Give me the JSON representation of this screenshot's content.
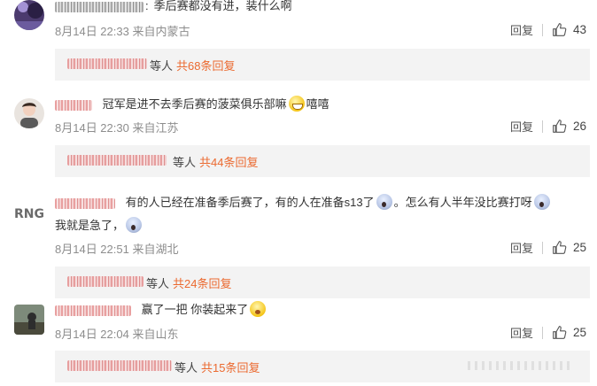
{
  "comments": [
    {
      "text": "季后赛都没有进，装什么啊",
      "date": "8月14日 22:33",
      "location": "来自内蒙古",
      "reply_label": "回复",
      "likes": "43",
      "sub": {
        "deng": "等人",
        "more": "共68条回复"
      }
    },
    {
      "text": "冠军是进不去季后赛的菠菜俱乐部嘛",
      "text_after_emoji": "嘻嘻",
      "date": "8月14日 22:30",
      "location": "来自江苏",
      "reply_label": "回复",
      "likes": "26",
      "sub": {
        "deng": "等人",
        "more": "共44条回复"
      }
    },
    {
      "text": "有的人已经在准备季后赛了，有的人在准备s13了",
      "text_mid": "。怎么有人半年没比赛打呀",
      "text_line2": "我就是急了，",
      "date": "8月14日 22:51",
      "location": "来自湖北",
      "reply_label": "回复",
      "likes": "25",
      "sub": {
        "deng": "等人",
        "more": "共24条回复"
      }
    },
    {
      "text": "赢了一把 你装起来了",
      "date": "8月14日 22:04",
      "location": "来自山东",
      "reply_label": "回复",
      "likes": "25",
      "sub": {
        "deng": "等人",
        "more": "共15条回复"
      }
    }
  ],
  "colors": {
    "accent": "#eb6a30",
    "meta": "#8d8d8d",
    "sub_bg": "#f3f3f3"
  }
}
